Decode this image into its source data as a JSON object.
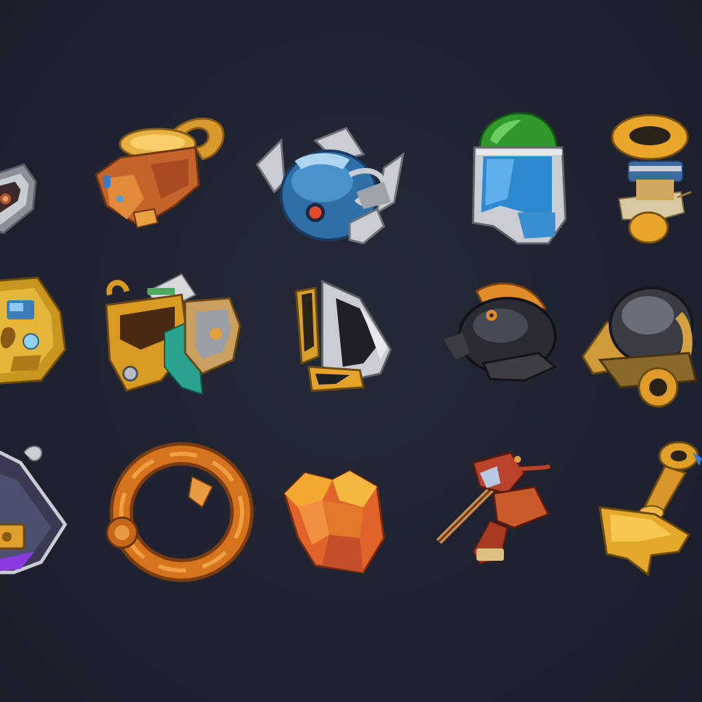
{
  "scene": {
    "background": "#1f2330"
  },
  "items": [
    {
      "id": "r1c0",
      "icon": "silver-badge-icon",
      "row": 1,
      "col": 0
    },
    {
      "id": "r1c1",
      "icon": "golden-gauntlet-icon",
      "row": 1,
      "col": 1
    },
    {
      "id": "r1c2",
      "icon": "blue-steel-helmet-icon",
      "row": 1,
      "col": 2
    },
    {
      "id": "r1c3",
      "icon": "green-dome-helmet-icon",
      "row": 1,
      "col": 3
    },
    {
      "id": "r1c4",
      "icon": "gold-ring-pedestal-icon",
      "row": 1,
      "col": 4
    },
    {
      "id": "r2c0",
      "icon": "ornate-gold-chest-icon",
      "row": 2,
      "col": 0
    },
    {
      "id": "r2c1",
      "icon": "gold-teal-shoulder-armor-icon",
      "row": 2,
      "col": 1
    },
    {
      "id": "r2c2",
      "icon": "steel-boot-icon",
      "row": 2,
      "col": 2
    },
    {
      "id": "r2c3",
      "icon": "black-iron-helmet-icon",
      "row": 2,
      "col": 3
    },
    {
      "id": "r2c4",
      "icon": "iron-cannon-icon",
      "row": 2,
      "col": 4
    },
    {
      "id": "r3c0",
      "icon": "purple-shield-icon",
      "row": 3,
      "col": 0
    },
    {
      "id": "r3c1",
      "icon": "bronze-ring-icon",
      "row": 3,
      "col": 1
    },
    {
      "id": "r3c2",
      "icon": "orange-crystal-icon",
      "row": 3,
      "col": 2
    },
    {
      "id": "r3c3",
      "icon": "red-crossbow-icon",
      "row": 3,
      "col": 3
    },
    {
      "id": "r3c4",
      "icon": "gold-bell-icon",
      "row": 3,
      "col": 4
    }
  ]
}
